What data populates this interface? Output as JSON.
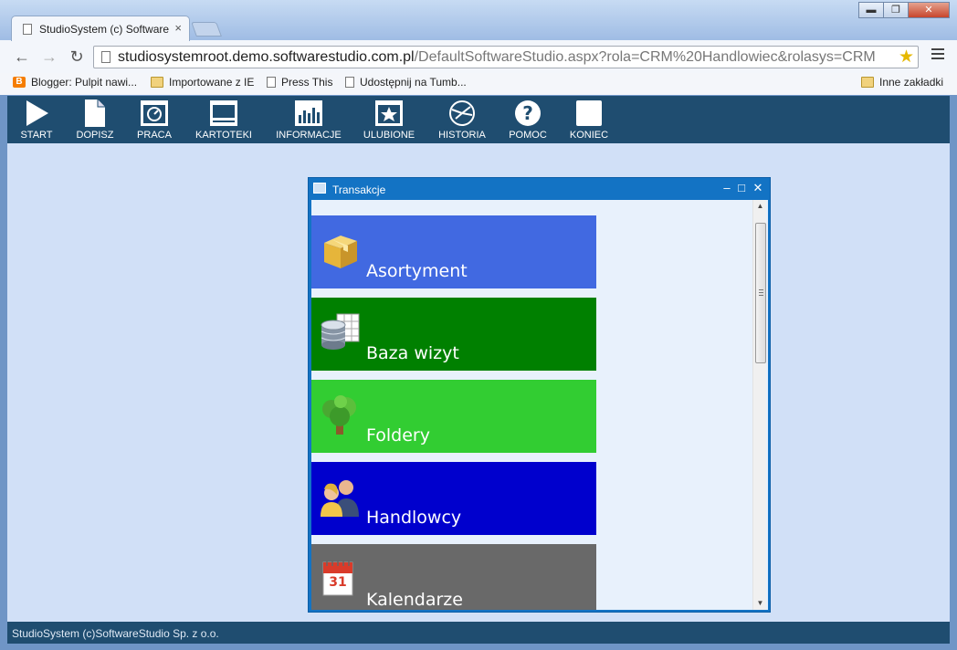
{
  "browser": {
    "tab_title": "StudioSystem (c) Software",
    "tab_close": "×",
    "url_host": "studiosystemroot.demo.softwarestudio.com.pl",
    "url_rest": "/DefaultSoftwareStudio.aspx?rola=CRM%20Handlowiec&rolasys=CRM",
    "window_buttons": {
      "minimize": "▬",
      "maximize": "❐",
      "close": "✕"
    },
    "nav": {
      "back": "←",
      "forward": "→",
      "reload": "↻"
    },
    "bookmarks": [
      {
        "label": "Blogger: Pulpit nawi...",
        "icon": "blogger-icon"
      },
      {
        "label": "Importowane z IE",
        "icon": "folder-icon"
      },
      {
        "label": "Press This",
        "icon": "page-icon"
      },
      {
        "label": "Udostępnij na Tumb...",
        "icon": "page-icon"
      }
    ],
    "other_bookmarks": "Inne zakładki"
  },
  "toolbar": {
    "items": [
      {
        "label": "START",
        "icon": "play-icon"
      },
      {
        "label": "DOPISZ",
        "icon": "new-document-icon"
      },
      {
        "label": "PRACA",
        "icon": "work-monitor-icon"
      },
      {
        "label": "KARTOTEKI",
        "icon": "records-icon"
      },
      {
        "label": "INFORMACJE",
        "icon": "chart-icon"
      },
      {
        "label": "ULUBIONE",
        "icon": "favorites-star-icon"
      },
      {
        "label": "HISTORIA",
        "icon": "history-icon"
      },
      {
        "label": "POMOC",
        "icon": "help-icon"
      },
      {
        "label": "KONIEC",
        "icon": "exit-icon"
      }
    ]
  },
  "dialog": {
    "title": "Transakcje",
    "buttons": {
      "minimize": "‒",
      "maximize": "□",
      "close": "✕"
    },
    "tiles": [
      {
        "label": "Asortyment",
        "color": "#4169e1",
        "icon": "box-icon"
      },
      {
        "label": "Baza wizyt",
        "color": "#008000",
        "icon": "database-icon"
      },
      {
        "label": "Foldery",
        "color": "#32cd32",
        "icon": "tree-icon"
      },
      {
        "label": "Handlowcy",
        "color": "#0000cd",
        "icon": "people-icon"
      },
      {
        "label": "Kalendarze",
        "color": "#696969",
        "icon": "calendar-icon"
      }
    ],
    "calendar_day": "31"
  },
  "footer": {
    "text": "StudioSystem (c)SoftwareStudio Sp. z o.o."
  }
}
